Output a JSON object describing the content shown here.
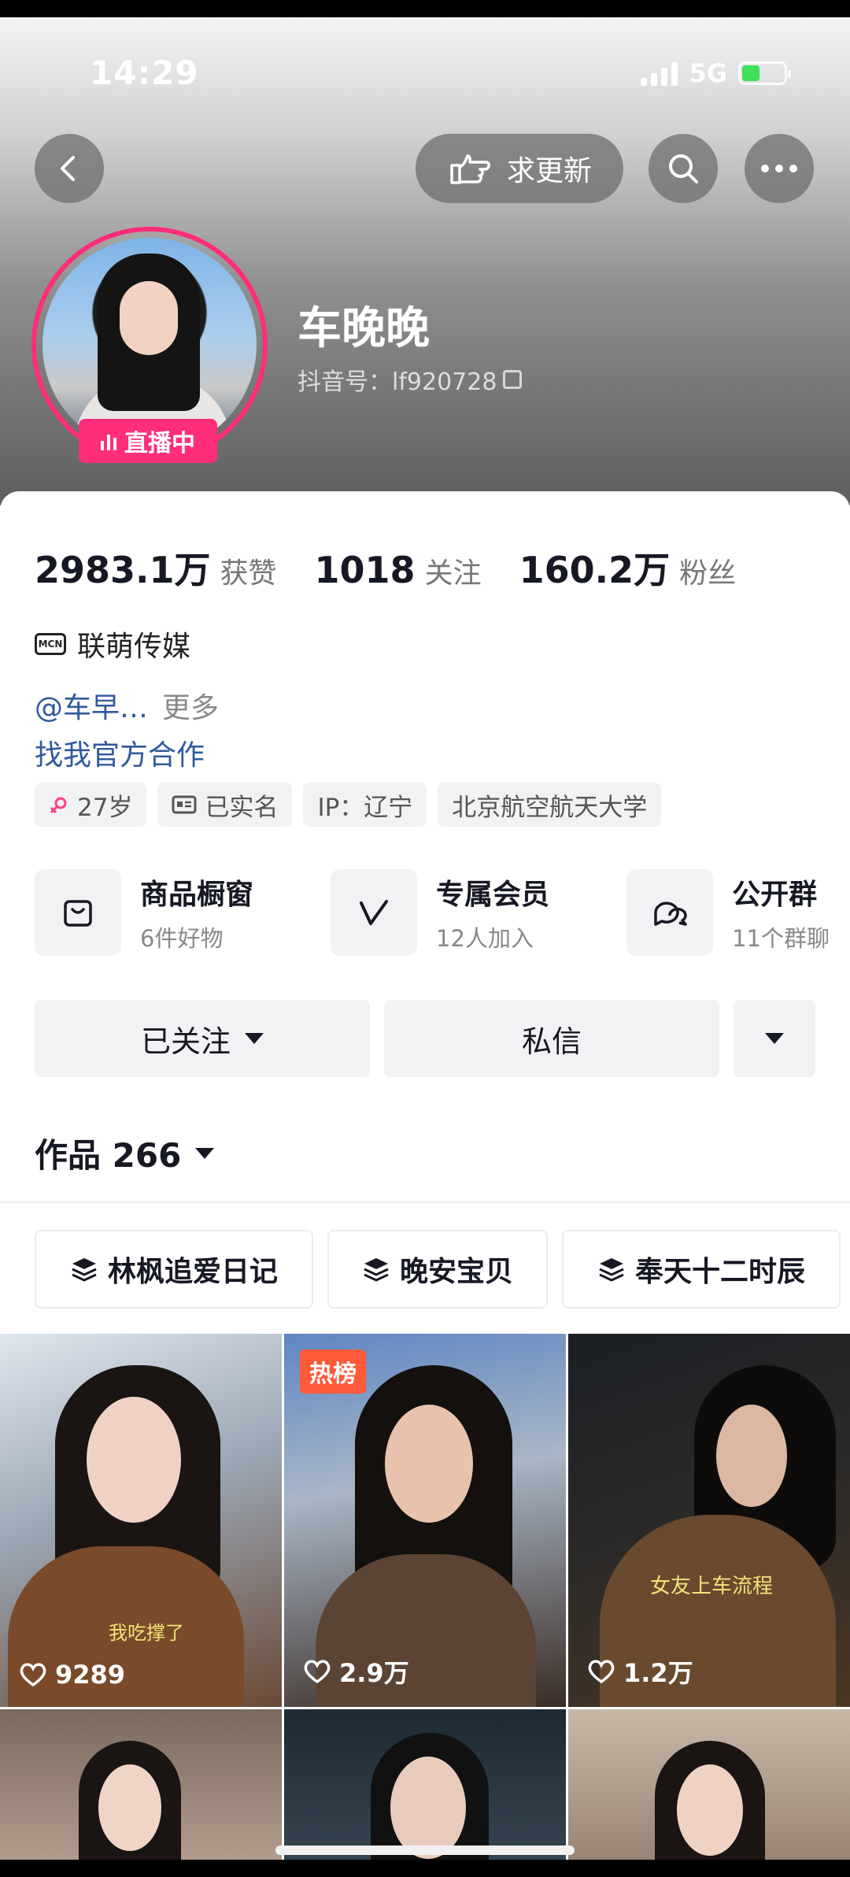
{
  "status_bar": {
    "time": "14:29",
    "network": "5G"
  },
  "header": {
    "update_label": "求更新"
  },
  "profile": {
    "name": "车晚晚",
    "douyin_id": "抖音号：lf920728",
    "live_label": "直播中"
  },
  "stats": [
    {
      "value": "2983.1万",
      "label": "获赞"
    },
    {
      "value": "1018",
      "label": "关注"
    },
    {
      "value": "160.2万",
      "label": "粉丝"
    }
  ],
  "mcn": {
    "icon_text": "MCN",
    "name": "联萌传媒"
  },
  "bio": {
    "mention": "@车早…",
    "more": "更多",
    "cooperation": "找我官方合作"
  },
  "tags": [
    "27岁",
    "已实名",
    "IP：辽宁",
    "北京航空航天大学"
  ],
  "features": [
    {
      "title": "商品橱窗",
      "sub": "6件好物"
    },
    {
      "title": "专属会员",
      "sub": "12人加入"
    },
    {
      "title": "公开群",
      "sub": "11个群聊"
    }
  ],
  "actions": {
    "followed": "已关注",
    "message": "私信"
  },
  "works": {
    "label": "作品 266"
  },
  "collections": [
    "林枫追爱日记",
    "晚安宝贝",
    "奉天十二时辰"
  ],
  "videos": [
    {
      "likes": "9289",
      "caption": "我吃撑了"
    },
    {
      "likes": "2.9万",
      "badge": "热榜"
    },
    {
      "likes": "1.2万",
      "caption": "女友上车流程"
    }
  ]
}
